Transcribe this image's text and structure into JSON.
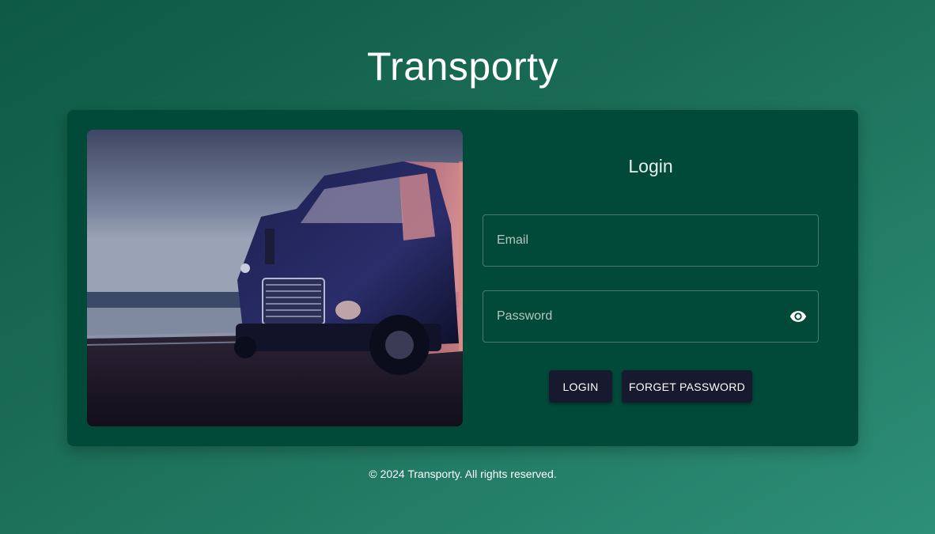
{
  "app": {
    "title": "Transporty"
  },
  "login": {
    "heading": "Login",
    "email_placeholder": "Email",
    "password_placeholder": "Password",
    "login_button": "LOGIN",
    "forget_button": "FORGET PASSWORD"
  },
  "icons": {
    "password_toggle": "eye-icon"
  },
  "hero": {
    "alt": "truck"
  },
  "footer": {
    "text": "© 2024 Transporty. All rights reserved."
  },
  "colors": {
    "card": "#014a39",
    "button": "#171a2e",
    "background_start": "#0e5a44",
    "background_end": "#2d8f78"
  }
}
